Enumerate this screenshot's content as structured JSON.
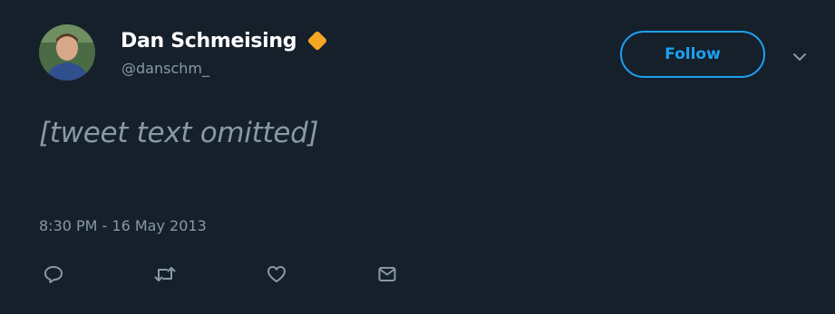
{
  "colors": {
    "background": "#15202b",
    "text_primary": "#ffffff",
    "text_secondary": "#8899a6",
    "accent": "#1da1f2",
    "badge": "#f5a623"
  },
  "author": {
    "display_name": "Dan Schmeising",
    "handle": "@danschm_",
    "badge_icon": "orange-diamond-icon",
    "avatar_icon": "avatar-photo"
  },
  "follow_button": {
    "label": "Follow"
  },
  "menu": {
    "icon": "chevron-down-icon"
  },
  "tweet": {
    "text": "[tweet text omitted]",
    "timestamp": "8:30 PM - 16 May 2013"
  },
  "actions": [
    {
      "icon": "reply-icon"
    },
    {
      "icon": "retweet-icon"
    },
    {
      "icon": "heart-icon"
    },
    {
      "icon": "direct-message-icon"
    }
  ]
}
